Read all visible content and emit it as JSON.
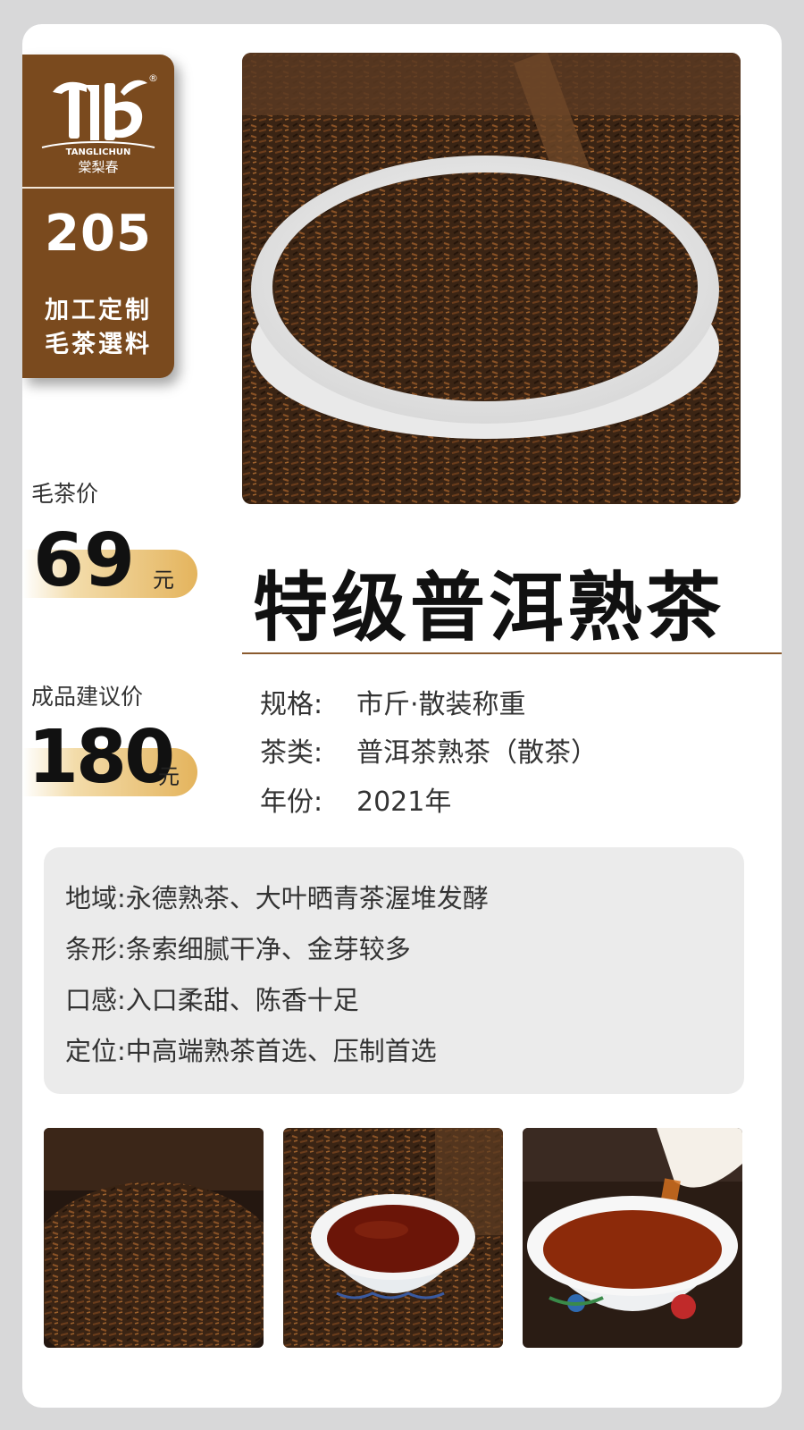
{
  "brand": {
    "latin": "TANGLICHUN",
    "chinese": "棠梨春",
    "registered": "®",
    "code": "205",
    "line1": "加工定制",
    "line2": "毛茶選料"
  },
  "raw_price": {
    "label": "毛茶价",
    "value": "69",
    "unit": "元"
  },
  "retail_price": {
    "label": "成品建议价",
    "value": "180",
    "unit": "元"
  },
  "title": "特级普洱熟茶",
  "specs": [
    {
      "label": "规格:",
      "value": "市斤·散装称重"
    },
    {
      "label": "茶类:",
      "value": "普洱茶熟茶（散茶）"
    },
    {
      "label": "年份:",
      "value": "2021年"
    }
  ],
  "details": [
    "地域:永德熟茶、大叶晒青茶渥堆发酵",
    "条形:条索细腻干净、金芽较多",
    "口感:入口柔甜、陈香十足",
    "定位:中高端熟茶首选、压制首选"
  ],
  "colors": {
    "brand_brown": "#7a4a1e",
    "gold": "#e4b45d",
    "page_bg": "#d8d8d9"
  }
}
